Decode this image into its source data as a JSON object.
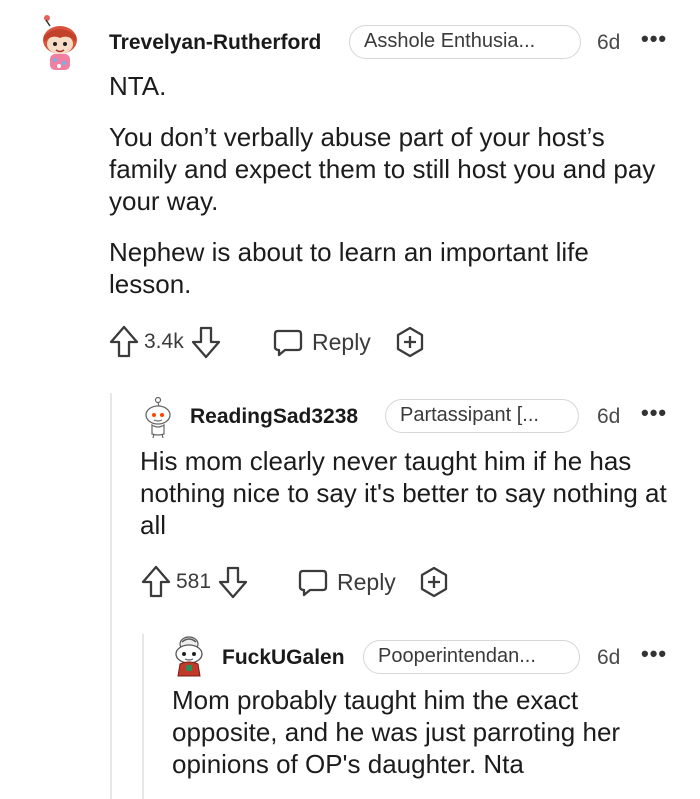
{
  "comments": [
    {
      "username": "Trevelyan-Rutherford",
      "flair": "Asshole Enthusia...",
      "time": "6d",
      "more_icon": "ellipsis-icon",
      "paragraphs": [
        "NTA.",
        "You don’t verbally abuse part of your host’s family and expect them to still host you and pay your way.",
        "Nephew is about to learn an important life lesson."
      ],
      "score": "3.4k",
      "reply_label": "Reply"
    },
    {
      "username": "ReadingSad3238",
      "flair": "Partassipant [...",
      "time": "6d",
      "more_icon": "ellipsis-icon",
      "paragraphs": [
        "His mom clearly never taught him if he has nothing nice to say it's better to say nothing at all"
      ],
      "score": "581",
      "reply_label": "Reply"
    },
    {
      "username": "FuckUGalen",
      "flair": "Pooperintendan...",
      "time": "6d",
      "more_icon": "ellipsis-icon",
      "paragraphs": [
        "Mom probably taught him the exact opposite, and he was just parroting her opinions of OP's daughter. Nta"
      ]
    }
  ],
  "icons": {
    "upvote": "upvote-arrow-icon",
    "downvote": "downvote-arrow-icon",
    "reply": "speech-bubble-icon",
    "award": "plus-award-icon"
  },
  "colors": {
    "text": "#1c1c1c",
    "muted": "#3b3b3b",
    "border": "#d6d6d6",
    "thread_line": "#e5e7eb"
  }
}
